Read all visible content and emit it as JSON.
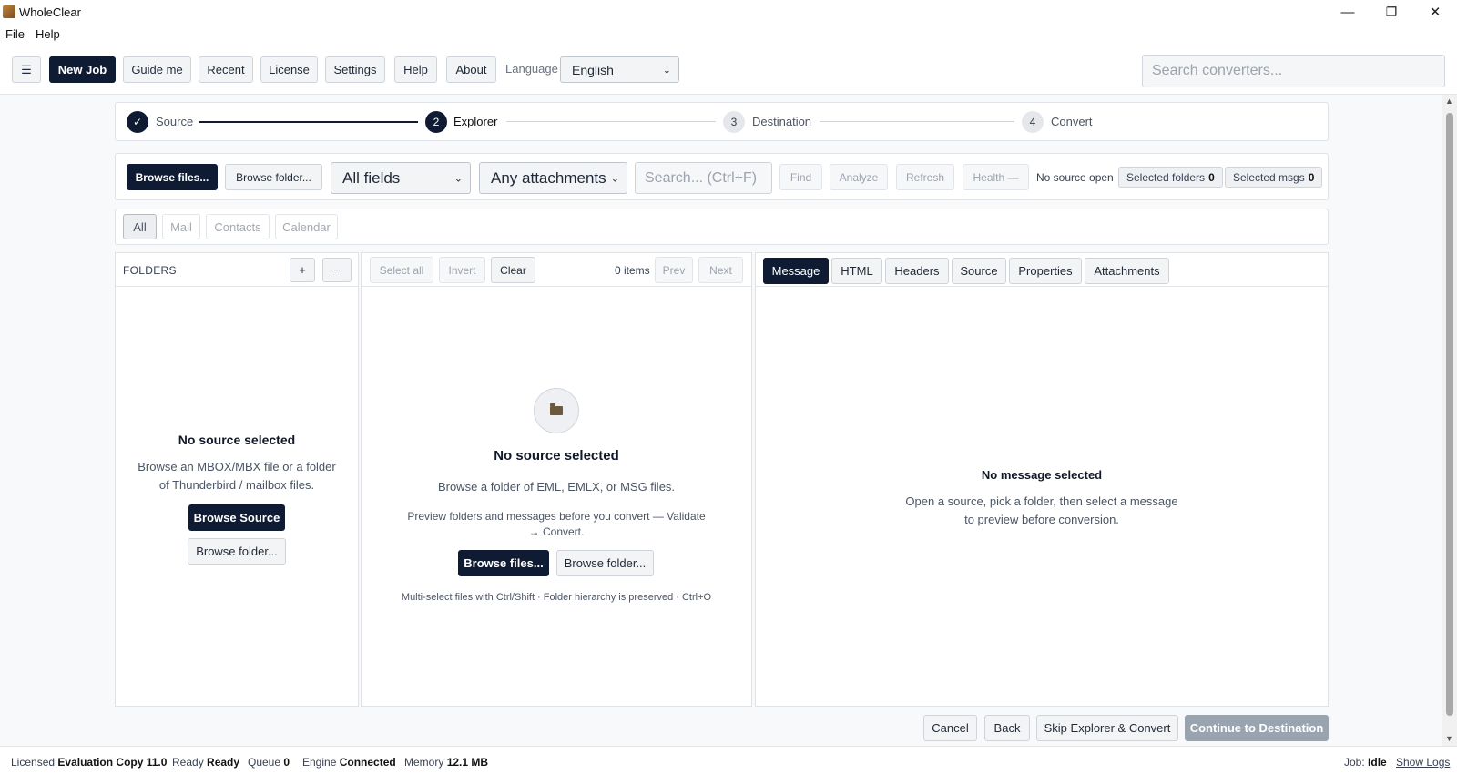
{
  "window": {
    "title": "WholeClear",
    "controls": {
      "minimize": "—",
      "restore": "❐",
      "close": "✕"
    }
  },
  "menu": [
    "File",
    "Help"
  ],
  "toolbar": {
    "hamburger": "☰",
    "new_job": "New Job",
    "guide_me": "Guide me",
    "recent": "Recent",
    "license": "License",
    "settings": "Settings",
    "help": "Help",
    "about": "About",
    "language_label": "Language",
    "language_value": "English",
    "search_placeholder": "Search converters..."
  },
  "stepper": {
    "steps": [
      {
        "number": "✓",
        "label": "Source",
        "state": "done"
      },
      {
        "number": "2",
        "label": "Explorer",
        "state": "active"
      },
      {
        "number": "3",
        "label": "Destination",
        "state": "pending"
      },
      {
        "number": "4",
        "label": "Convert",
        "state": "pending"
      }
    ]
  },
  "filterbar": {
    "browse_files": "Browse files...",
    "browse_folder": "Browse folder...",
    "fields_select": "All fields",
    "attachments_select": "Any attachments",
    "search_placeholder": "Search... (Ctrl+F)",
    "find": "Find",
    "analyze": "Analyze",
    "refresh": "Refresh",
    "health": "Health —",
    "no_source": "No source open",
    "selected_folders_label": "Selected folders",
    "selected_folders_count": "0",
    "selected_msgs_label": "Selected msgs",
    "selected_msgs_count": "0"
  },
  "type_tabs": [
    "All",
    "Mail",
    "Contacts",
    "Calendar"
  ],
  "folders_panel": {
    "title": "FOLDERS",
    "add": "+",
    "remove": "−",
    "empty_title": "No source selected",
    "empty_text": "Browse an MBOX/MBX file or a folder of Thunderbird / mailbox files.",
    "browse_source": "Browse Source",
    "browse_folder": "Browse folder..."
  },
  "messages_panel": {
    "select_all": "Select all",
    "invert": "Invert",
    "clear": "Clear",
    "items": "0 items",
    "prev": "Prev",
    "next": "Next",
    "empty_title": "No source selected",
    "empty_text": "Browse a folder of EML, EMLX, or MSG files.",
    "preview_text": "Preview folders and messages before you convert — Validate → Convert.",
    "browse_files": "Browse files...",
    "browse_folder": "Browse folder...",
    "hint": "Multi-select files with Ctrl/Shift · Folder hierarchy is preserved · Ctrl+O"
  },
  "preview_panel": {
    "tabs": [
      "Message",
      "HTML",
      "Headers",
      "Source",
      "Properties",
      "Attachments"
    ],
    "empty_title": "No message selected",
    "empty_text": "Open a source, pick a folder, then select a message to preview before conversion."
  },
  "actions": {
    "cancel": "Cancel",
    "back": "Back",
    "skip": "Skip Explorer & Convert",
    "continue": "Continue to Destination"
  },
  "status": {
    "licensed_label": "Licensed",
    "licensed_value": "Evaluation Copy 11.0",
    "ready_label": "Ready",
    "ready_value": "Ready",
    "queue_label": "Queue",
    "queue_value": "0",
    "engine_label": "Engine",
    "engine_value": "Connected",
    "memory_label": "Memory",
    "memory_value": "12.1 MB",
    "job_label": "Job:",
    "job_value": "Idle",
    "show_logs": "Show Logs"
  }
}
